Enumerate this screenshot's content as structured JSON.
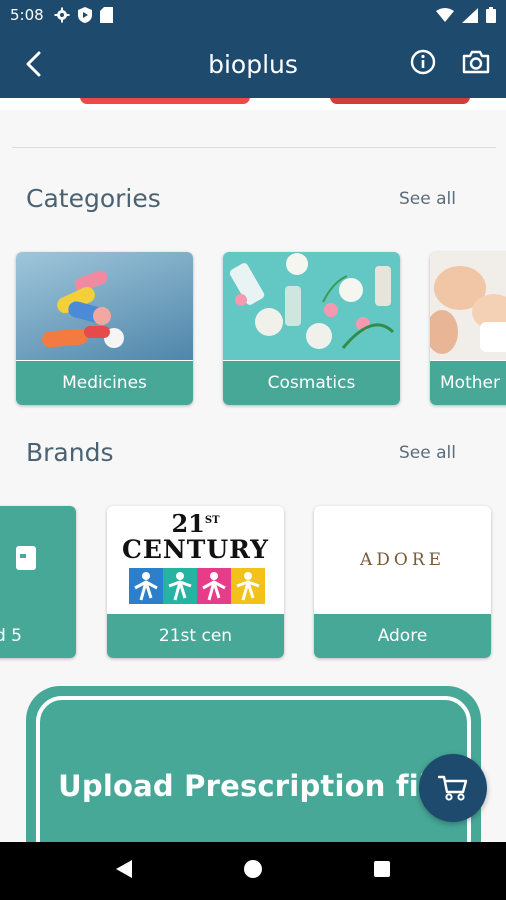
{
  "status_bar": {
    "time": "5:08",
    "left_icons": [
      "gear-icon",
      "shield-play-icon",
      "sd-card-icon"
    ],
    "right_icons": [
      "wifi-icon",
      "signal-icon",
      "battery-icon"
    ]
  },
  "app_bar": {
    "title": "bioplus",
    "back_icon": "back-arrow-icon",
    "actions": [
      "info-icon",
      "camera-icon"
    ]
  },
  "categories": {
    "title": "Categories",
    "see_all": "See all",
    "items": [
      {
        "label": "Medicines",
        "image": "pills-photo"
      },
      {
        "label": "Cosmatics",
        "image": "cosmetics-photo"
      },
      {
        "label": "Mother",
        "image": "baby-photo"
      }
    ]
  },
  "brands": {
    "title": "Brands",
    "see_all": "See all",
    "items": [
      {
        "label": "d 5",
        "logo": "brand-placeholder-icon"
      },
      {
        "label": "21st cen",
        "logo_line1": "21",
        "logo_sup": "ST",
        "logo_line2": "CENTURY"
      },
      {
        "label": "Adore",
        "logo_text": "ADORE"
      }
    ]
  },
  "upload": {
    "label": "Upload Prescription file"
  },
  "fab": {
    "icon": "cart-icon"
  },
  "nav_bar": {
    "icons": [
      "back-triangle-icon",
      "home-circle-icon",
      "recents-square-icon"
    ]
  },
  "colors": {
    "primary": "#1e4a6e",
    "accent": "#47a898",
    "background": "#f7f7f7"
  }
}
